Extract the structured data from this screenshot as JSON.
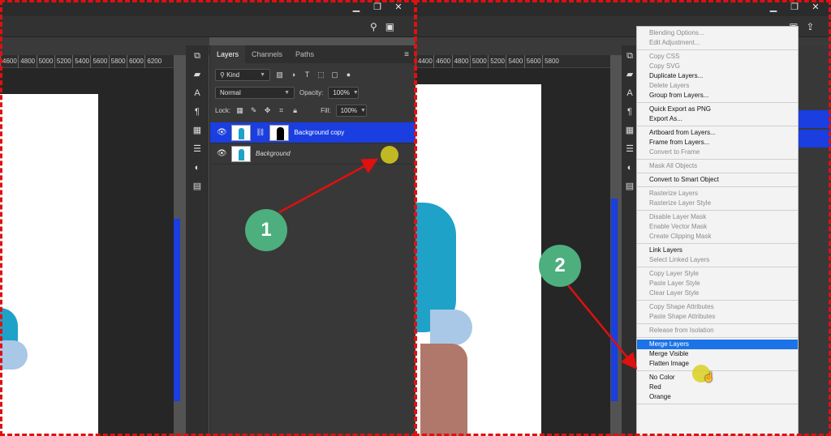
{
  "left": {
    "ruler_ticks": [
      "4600",
      "4800",
      "5000",
      "5200",
      "5400",
      "5600",
      "5800",
      "6000",
      "6200"
    ],
    "tabs": [
      "Layers",
      "Channels",
      "Paths"
    ],
    "filter": {
      "label": "Kind"
    },
    "blend_mode": "Normal",
    "opacity": {
      "label": "Opacity:",
      "value": "100%"
    },
    "lock_label": "Lock:",
    "fill": {
      "label": "Fill:",
      "value": "100%"
    },
    "layers": [
      {
        "name": "Background copy",
        "selected": true
      },
      {
        "name": "Background",
        "selected": false
      }
    ],
    "step_label": "1"
  },
  "right": {
    "ruler_ticks": [
      "4400",
      "4600",
      "4800",
      "5000",
      "5200",
      "5400",
      "5600",
      "5800"
    ],
    "step_label": "2",
    "menu_groups": [
      [
        {
          "label": "Blending Options...",
          "disabled": true
        },
        {
          "label": "Edit Adjustment...",
          "disabled": true
        }
      ],
      [
        {
          "label": "Copy CSS",
          "disabled": true
        },
        {
          "label": "Copy SVG",
          "disabled": true
        },
        {
          "label": "Duplicate Layers...",
          "disabled": false
        },
        {
          "label": "Delete Layers",
          "disabled": true
        },
        {
          "label": "Group from Layers...",
          "disabled": false
        }
      ],
      [
        {
          "label": "Quick Export as PNG",
          "disabled": false
        },
        {
          "label": "Export As...",
          "disabled": false
        }
      ],
      [
        {
          "label": "Artboard from Layers...",
          "disabled": false
        },
        {
          "label": "Frame from Layers...",
          "disabled": false
        },
        {
          "label": "Convert to Frame",
          "disabled": true
        }
      ],
      [
        {
          "label": "Mask All Objects",
          "disabled": true
        }
      ],
      [
        {
          "label": "Convert to Smart Object",
          "disabled": false
        }
      ],
      [
        {
          "label": "Rasterize Layers",
          "disabled": true
        },
        {
          "label": "Rasterize Layer Style",
          "disabled": true
        }
      ],
      [
        {
          "label": "Disable Layer Mask",
          "disabled": true
        },
        {
          "label": "Enable Vector Mask",
          "disabled": true
        },
        {
          "label": "Create Clipping Mask",
          "disabled": true
        }
      ],
      [
        {
          "label": "Link Layers",
          "disabled": false
        },
        {
          "label": "Select Linked Layers",
          "disabled": true
        }
      ],
      [
        {
          "label": "Copy Layer Style",
          "disabled": true
        },
        {
          "label": "Paste Layer Style",
          "disabled": true
        },
        {
          "label": "Clear Layer Style",
          "disabled": true
        }
      ],
      [
        {
          "label": "Copy Shape Attributes",
          "disabled": true
        },
        {
          "label": "Paste Shape Attributes",
          "disabled": true
        }
      ],
      [
        {
          "label": "Release from Isolation",
          "disabled": true
        }
      ],
      [
        {
          "label": "Merge Layers",
          "disabled": false,
          "highlighted": true
        },
        {
          "label": "Merge Visible",
          "disabled": false
        },
        {
          "label": "Flatten Image",
          "disabled": false
        }
      ],
      [
        {
          "label": "No Color",
          "disabled": false
        },
        {
          "label": "Red",
          "disabled": false
        },
        {
          "label": "Orange",
          "disabled": false
        }
      ]
    ]
  },
  "colors": {
    "selection_blue": "#1a3ee0",
    "menu_highlight": "#1b73e8",
    "annotation_red": "#e01010",
    "badge_green": "#4caf7d"
  }
}
